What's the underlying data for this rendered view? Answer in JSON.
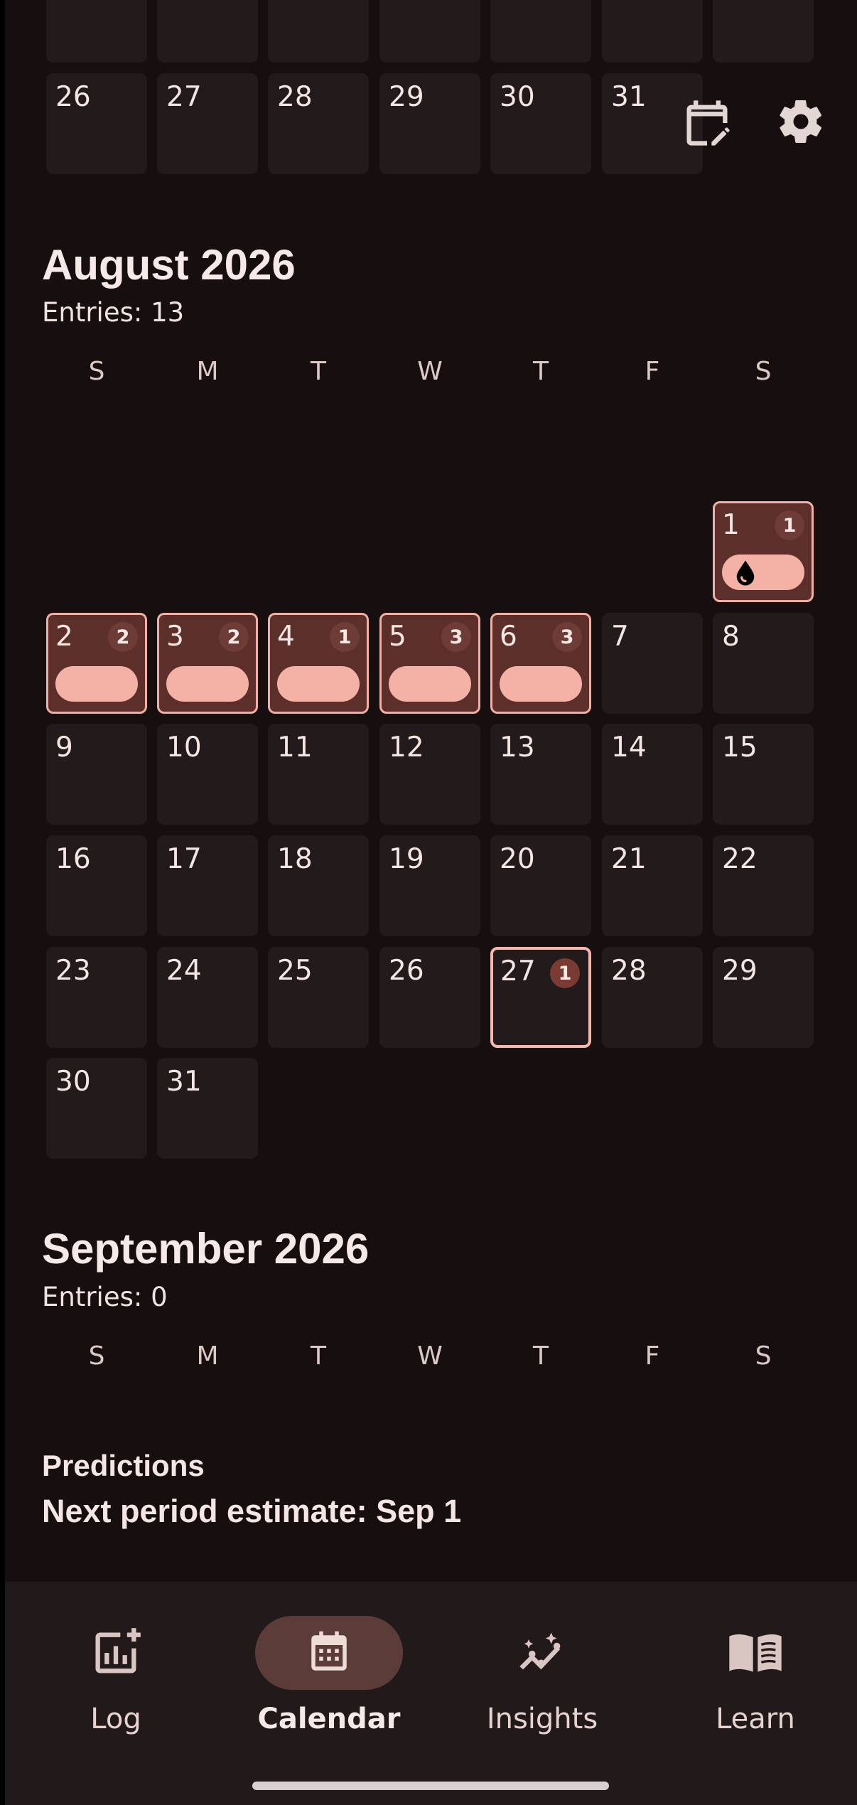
{
  "july_tail": {
    "row_top_days": [
      "",
      "",
      "",
      "",
      "",
      "",
      ""
    ],
    "row_days": [
      "26",
      "27",
      "28",
      "29",
      "30",
      "31"
    ]
  },
  "toolbar": {
    "edit_calendar_icon": "calendar-edit-icon",
    "settings_icon": "gear-icon"
  },
  "weekday_labels": [
    "S",
    "M",
    "T",
    "W",
    "T",
    "F",
    "S"
  ],
  "august": {
    "title": "August 2026",
    "entries": "Entries: 13",
    "days": [
      {
        "day": "1",
        "count": "1",
        "logged": true,
        "icon": "drop-icon"
      },
      {
        "day": "2",
        "count": "2",
        "logged": true
      },
      {
        "day": "3",
        "count": "2",
        "logged": true
      },
      {
        "day": "4",
        "count": "1",
        "logged": true
      },
      {
        "day": "5",
        "count": "3",
        "logged": true
      },
      {
        "day": "6",
        "count": "3",
        "logged": true
      },
      {
        "day": "7"
      },
      {
        "day": "8"
      },
      {
        "day": "9"
      },
      {
        "day": "10"
      },
      {
        "day": "11"
      },
      {
        "day": "12"
      },
      {
        "day": "13"
      },
      {
        "day": "14"
      },
      {
        "day": "15"
      },
      {
        "day": "16"
      },
      {
        "day": "17"
      },
      {
        "day": "18"
      },
      {
        "day": "19"
      },
      {
        "day": "20"
      },
      {
        "day": "21"
      },
      {
        "day": "22"
      },
      {
        "day": "23"
      },
      {
        "day": "24"
      },
      {
        "day": "25"
      },
      {
        "day": "26"
      },
      {
        "day": "27",
        "count": "1",
        "today": true
      },
      {
        "day": "28"
      },
      {
        "day": "29"
      },
      {
        "day": "30"
      },
      {
        "day": "31"
      }
    ]
  },
  "september": {
    "title": "September 2026",
    "entries": "Entries: 0"
  },
  "predictions": {
    "title": "Predictions",
    "text": "Next period estimate: Sep 1"
  },
  "nav": {
    "items": [
      {
        "label": "Log",
        "icon": "chart-add-icon",
        "active": false
      },
      {
        "label": "Calendar",
        "icon": "calendar-icon",
        "active": true
      },
      {
        "label": "Insights",
        "icon": "insights-sparkle-icon",
        "active": false
      },
      {
        "label": "Learn",
        "icon": "book-icon",
        "active": false
      }
    ]
  },
  "colors": {
    "background": "#170f0f",
    "cell": "#231b1b",
    "logged_cell": "#5d2f2a",
    "accent_pink": "#f4b2a6",
    "nav_bg": "#221a1a"
  }
}
